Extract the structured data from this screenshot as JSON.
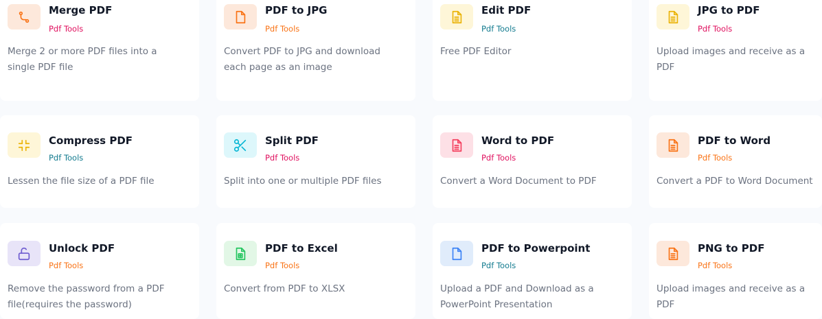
{
  "tools": [
    {
      "name": "merge",
      "title": "Merge PDF",
      "category": "Pdf Tools",
      "category_color": "#e0115f",
      "icon": "merge-icon",
      "icon_color": "#f97316",
      "icon_bg": "#fde8db",
      "description": "Merge 2 or more PDF files into a single PDF file"
    },
    {
      "name": "pdf-to-jpg",
      "title": "PDF to JPG",
      "category": "Pdf Tools",
      "category_color": "#f97316",
      "icon": "file-icon",
      "icon_color": "#f97316",
      "icon_bg": "#fde8db",
      "description": "Convert PDF to JPG and download each page as an image"
    },
    {
      "name": "edit-pdf",
      "title": "Edit PDF",
      "category": "Pdf Tools",
      "category_color": "#137b8f",
      "icon": "document-icon",
      "icon_color": "#eab308",
      "icon_bg": "#fef6d8",
      "description": "Free PDF Editor"
    },
    {
      "name": "jpg-to-pdf",
      "title": "JPG to PDF",
      "category": "Pdf Tools",
      "category_color": "#e0115f",
      "icon": "document-icon",
      "icon_color": "#eab308",
      "icon_bg": "#fef6d8",
      "description": "Upload images and receive as a PDF"
    },
    {
      "name": "compress",
      "title": "Compress PDF",
      "category": "Pdf Tools",
      "category_color": "#137b8f",
      "icon": "compress-icon",
      "icon_color": "#eab308",
      "icon_bg": "#fef6d8",
      "description": "Lessen the file size of a PDF file"
    },
    {
      "name": "split",
      "title": "Split PDF",
      "category": "Pdf Tools",
      "category_color": "#e0115f",
      "icon": "scissors-icon",
      "icon_color": "#06b6d4",
      "icon_bg": "#ddf7fb",
      "description": "Split into one or multiple PDF files"
    },
    {
      "name": "word-to-pdf",
      "title": "Word to PDF",
      "category": "Pdf Tools",
      "category_color": "#e0115f",
      "icon": "document-icon",
      "icon_color": "#f43f5e",
      "icon_bg": "#fde0e6",
      "description": "Convert a Word Document to PDF"
    },
    {
      "name": "pdf-to-word",
      "title": "PDF to Word",
      "category": "Pdf Tools",
      "category_color": "#f97316",
      "icon": "document-icon",
      "icon_color": "#f97316",
      "icon_bg": "#fde8db",
      "description": "Convert a PDF to Word Document"
    },
    {
      "name": "unlock",
      "title": "Unlock PDF",
      "category": "Pdf Tools",
      "category_color": "#f97316",
      "icon": "unlock-icon",
      "icon_color": "#6d5bd0",
      "icon_bg": "#e8e4f8",
      "description": "Remove the password from a PDF file(requires the password)"
    },
    {
      "name": "pdf-to-excel",
      "title": "PDF to Excel",
      "category": "Pdf Tools",
      "category_color": "#f97316",
      "icon": "spreadsheet-icon",
      "icon_color": "#22c55e",
      "icon_bg": "#e2f7e6",
      "description": "Convert from PDF to XLSX"
    },
    {
      "name": "pdf-to-powerpoint",
      "title": "PDF to Powerpoint",
      "category": "Pdf Tools",
      "category_color": "#137b8f",
      "icon": "file-icon",
      "icon_color": "#3b82f6",
      "icon_bg": "#e0ecfb",
      "description": "Upload a PDF and Download as a PowerPoint Presentation"
    },
    {
      "name": "png-to-pdf",
      "title": "PNG to PDF",
      "category": "Pdf Tools",
      "category_color": "#f97316",
      "icon": "document-icon",
      "icon_color": "#f97316",
      "icon_bg": "#fde8db",
      "description": "Upload images and receive as a PDF"
    }
  ]
}
